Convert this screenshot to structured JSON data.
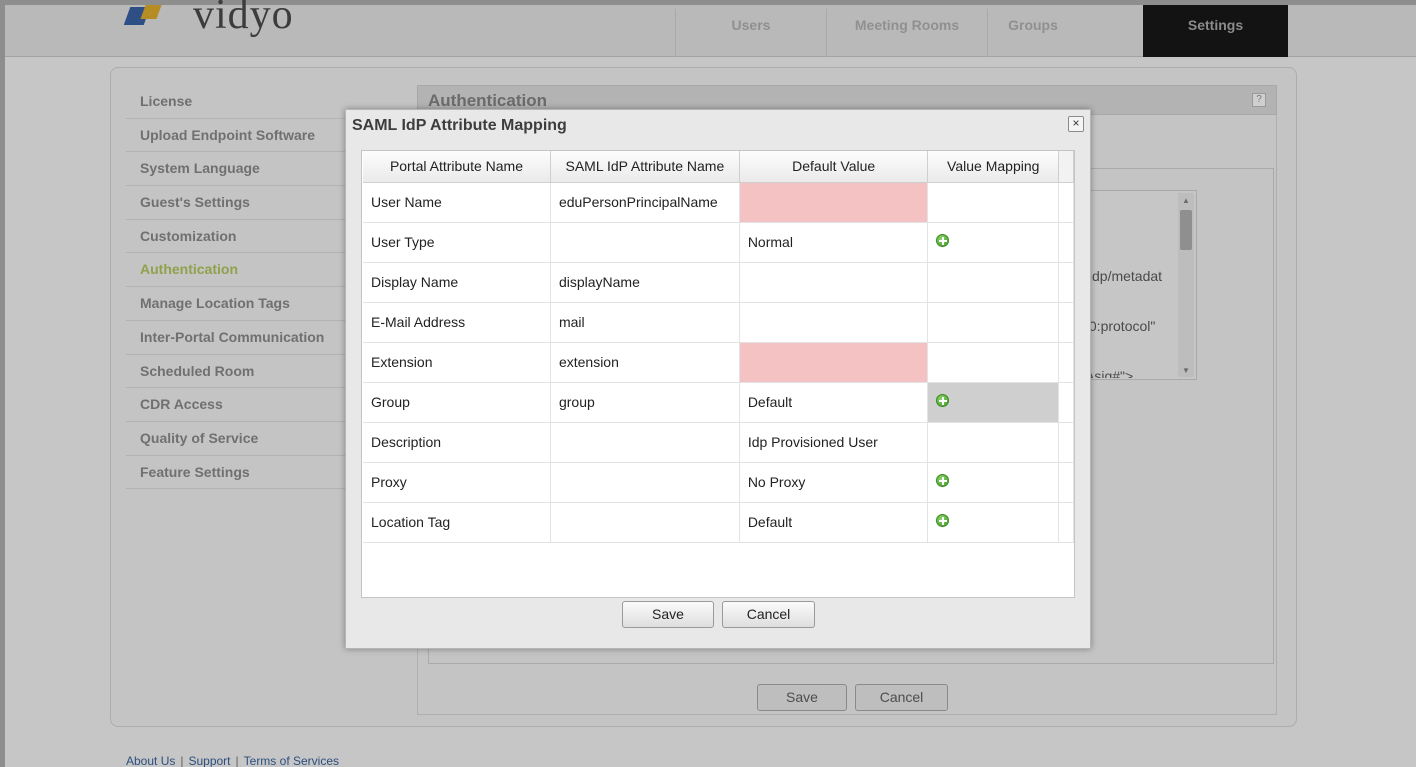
{
  "app": {
    "logo_text": "vidyo",
    "nav": [
      {
        "label": "Users"
      },
      {
        "label": "Meeting Rooms"
      },
      {
        "label": "Groups"
      },
      {
        "label": "Settings",
        "active": true
      }
    ]
  },
  "sidebar": {
    "items": [
      {
        "label": "License"
      },
      {
        "label": "Upload Endpoint Software"
      },
      {
        "label": "System Language"
      },
      {
        "label": "Guest's Settings"
      },
      {
        "label": "Customization"
      },
      {
        "label": "Authentication",
        "active": true
      },
      {
        "label": "Manage Location Tags"
      },
      {
        "label": "Inter-Portal Communication"
      },
      {
        "label": "Scheduled Room"
      },
      {
        "label": "CDR Access"
      },
      {
        "label": "Quality of Service"
      },
      {
        "label": "Feature Settings"
      }
    ]
  },
  "content": {
    "title": "Authentication",
    "help_label": "?",
    "metadata_lines": [
      "/idp/metadat",
      ".0:protocol\"",
      "Asig#\">"
    ],
    "save_label": "Save",
    "cancel_label": "Cancel"
  },
  "dialog": {
    "title": "SAML IdP Attribute Mapping",
    "close_label": "×",
    "columns": [
      "Portal Attribute Name",
      "SAML IdP Attribute Name",
      "Default Value",
      "Value Mapping"
    ],
    "rows": [
      {
        "portal": "User Name",
        "saml": "eduPersonPrincipalName",
        "default": "",
        "mapping_icon": false,
        "default_invalid": true
      },
      {
        "portal": "User Type",
        "saml": "",
        "default": "Normal",
        "mapping_icon": true
      },
      {
        "portal": "Display Name",
        "saml": "displayName",
        "default": "",
        "mapping_icon": false
      },
      {
        "portal": "E-Mail Address",
        "saml": "mail",
        "default": "",
        "mapping_icon": false
      },
      {
        "portal": "Extension",
        "saml": "extension",
        "default": "",
        "mapping_icon": false,
        "default_invalid": true
      },
      {
        "portal": "Group",
        "saml": "group",
        "default": "Default",
        "mapping_icon": true,
        "selected_mapping": true
      },
      {
        "portal": "Description",
        "saml": "",
        "default": "Idp Provisioned User",
        "mapping_icon": false
      },
      {
        "portal": "Proxy",
        "saml": "",
        "default": "No Proxy",
        "mapping_icon": true
      },
      {
        "portal": "Location Tag",
        "saml": "",
        "default": "Default",
        "mapping_icon": true
      }
    ],
    "save_label": "Save",
    "cancel_label": "Cancel",
    "mapping_icon_name": "add-circle-icon"
  },
  "footer": {
    "links": [
      "About Us",
      "Support",
      "Terms of Services"
    ],
    "separator": "|"
  },
  "colors": {
    "invalid_cell": "#f4c2c2",
    "active_sidebar": "#8fa14b",
    "mapping_icon": "#3f9a26"
  }
}
